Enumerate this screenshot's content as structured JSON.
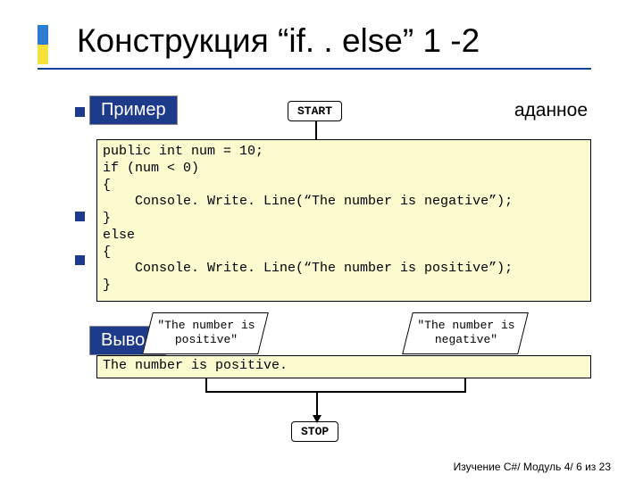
{
  "title": "Конструкция “if. . else” 1 -2",
  "labels": {
    "primer": "Пример",
    "vyvod": "Вывод"
  },
  "partial_bg_text": "аданное",
  "flow": {
    "start": "START",
    "stop": "STOP",
    "positive": "\"The number\nis positive\"",
    "negative": "\"The number\nis negative\""
  },
  "code": "public int num = 10;\nif (num < 0)\n{\n    Console. Write. Line(“The number is negative”);\n}\nelse\n{\n    Console. Write. Line(“The number is positive”);\n}",
  "output": "The number is positive.",
  "footer": "Изучение C#/ Модуль 4/ 6 из 23"
}
